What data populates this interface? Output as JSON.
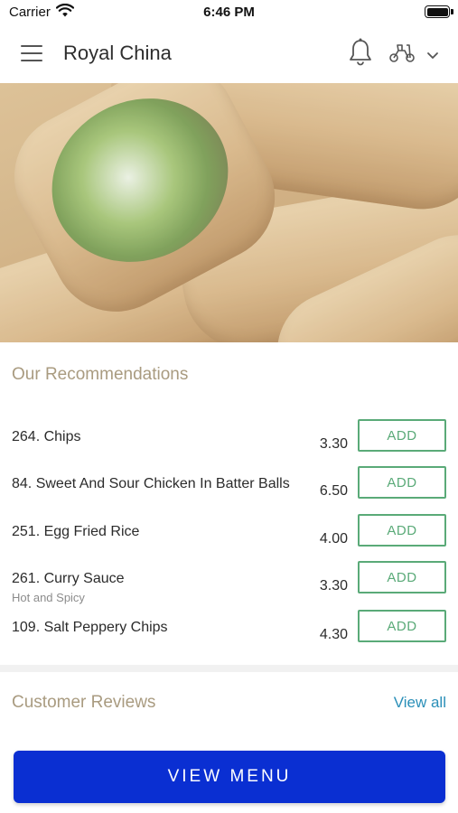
{
  "status_bar": {
    "carrier": "Carrier",
    "time": "6:46 PM"
  },
  "header": {
    "title": "Royal China",
    "icons": {
      "menu": "menu-icon",
      "notifications": "bell-icon",
      "delivery": "scooter-icon",
      "dropdown": "chevron-down-icon"
    }
  },
  "hero": {
    "image": "spring-rolls-photo"
  },
  "recommendations": {
    "title": "Our Recommendations",
    "items": [
      {
        "name": "264. Chips",
        "description": "",
        "price": "3.30",
        "add_label": "ADD"
      },
      {
        "name": "84. Sweet And Sour Chicken In Batter Balls",
        "description": "",
        "price": "6.50",
        "add_label": "ADD"
      },
      {
        "name": "251. Egg Fried Rice",
        "description": "",
        "price": "4.00",
        "add_label": "ADD"
      },
      {
        "name": "261. Curry Sauce",
        "description": "Hot and Spicy",
        "price": "3.30",
        "add_label": "ADD"
      },
      {
        "name": "109. Salt Peppery Chips",
        "description": "",
        "price": "4.30",
        "add_label": "ADD"
      }
    ]
  },
  "reviews": {
    "title": "Customer Reviews",
    "view_all_label": "View all"
  },
  "footer": {
    "view_menu_label": "VIEW MENU"
  },
  "colors": {
    "accent_green": "#5aaa78",
    "primary_blue": "#0a2fd2",
    "link_blue": "#2a8fb8",
    "section_title": "#a99b80"
  }
}
